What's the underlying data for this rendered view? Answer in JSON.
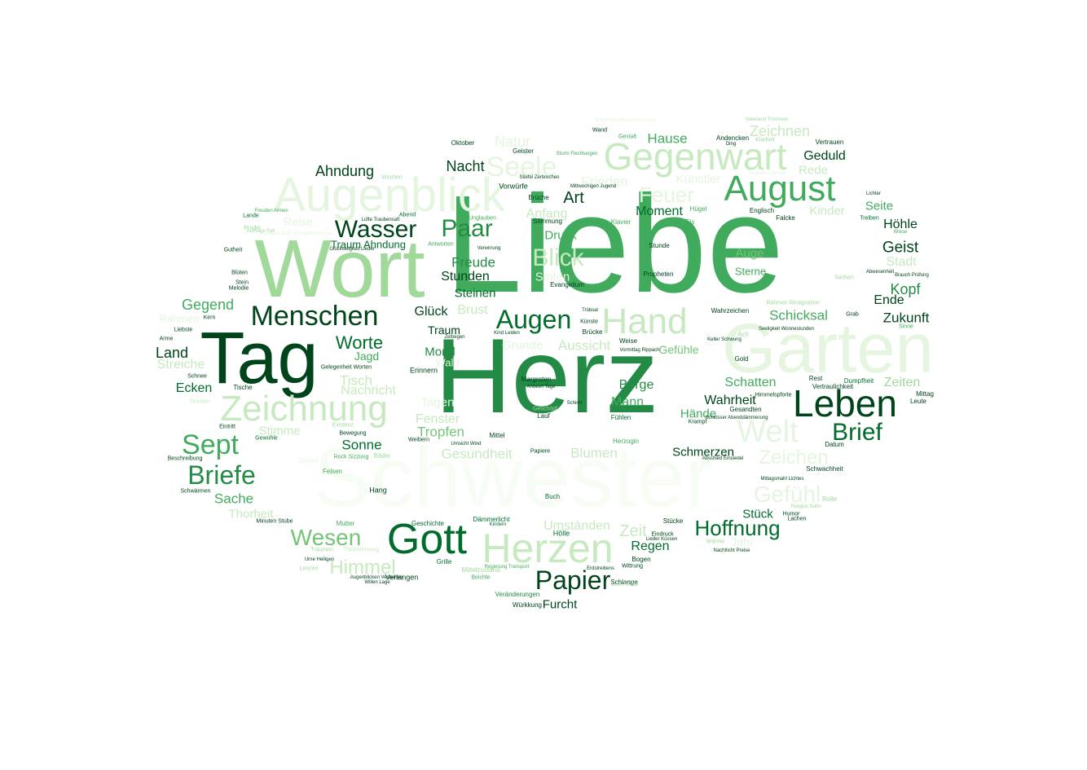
{
  "word_cloud": {
    "palette": {
      "darkest": "#00441b",
      "dark": "#006d2c",
      "medium_dark": "#238b45",
      "medium": "#41ab5d",
      "light": "#74c476",
      "lighter": "#a1d99b",
      "pale": "#c7e9c0",
      "palest": "#e5f5e0",
      "faint": "#f7fcf5"
    },
    "words": [
      {
        "text": "Liebe"
      },
      {
        "text": "Herz"
      },
      {
        "text": "Schwester"
      },
      {
        "text": "Wort"
      },
      {
        "text": "Tag"
      },
      {
        "text": "Garten"
      },
      {
        "text": "Augenblick"
      },
      {
        "text": "Gegenwart"
      },
      {
        "text": "Leben"
      },
      {
        "text": "Zeichnung"
      },
      {
        "text": "Hand"
      },
      {
        "text": "August"
      },
      {
        "text": "Herzen"
      },
      {
        "text": "Gott"
      },
      {
        "text": "Menschen"
      },
      {
        "text": "Welt"
      },
      {
        "text": "Wasser"
      },
      {
        "text": "Augen"
      },
      {
        "text": "Seele"
      },
      {
        "text": "Paar"
      },
      {
        "text": "Briefe"
      },
      {
        "text": "Sept"
      },
      {
        "text": "Papier"
      },
      {
        "text": "Brief"
      },
      {
        "text": "Blick"
      },
      {
        "text": "Wesen"
      },
      {
        "text": "Gefühl"
      },
      {
        "text": "Hoffnung"
      },
      {
        "text": "Feuer"
      },
      {
        "text": "Zeichen"
      },
      {
        "text": "Himmel"
      },
      {
        "text": "Worte"
      },
      {
        "text": "Ahndung"
      },
      {
        "text": "Nacht"
      },
      {
        "text": "Natur"
      },
      {
        "text": "Zeichnen"
      },
      {
        "text": "Hause"
      },
      {
        "text": "Geduld"
      },
      {
        "text": "Rede"
      },
      {
        "text": "Künstler"
      },
      {
        "text": "Frieden"
      },
      {
        "text": "Art"
      },
      {
        "text": "Anfang"
      },
      {
        "text": "Moment"
      },
      {
        "text": "Kinder"
      },
      {
        "text": "Seite"
      },
      {
        "text": "Höhle"
      },
      {
        "text": "Geist"
      },
      {
        "text": "Stadt"
      },
      {
        "text": "Kopf"
      },
      {
        "text": "Ende"
      },
      {
        "text": "Zukunft"
      },
      {
        "text": "Auge"
      },
      {
        "text": "Sterne"
      },
      {
        "text": "Schicksal"
      },
      {
        "text": "Druck"
      },
      {
        "text": "Freude"
      },
      {
        "text": "Seiten"
      },
      {
        "text": "Stunden"
      },
      {
        "text": "Steinen"
      },
      {
        "text": "Glück"
      },
      {
        "text": "Brust"
      },
      {
        "text": "Traum"
      },
      {
        "text": "Mond"
      },
      {
        "text": "Jagd"
      },
      {
        "text": "Land"
      },
      {
        "text": "Streiche"
      },
      {
        "text": "Gegend"
      },
      {
        "text": "Tisch"
      },
      {
        "text": "Nachricht"
      },
      {
        "text": "Ecken"
      },
      {
        "text": "Tagen"
      },
      {
        "text": "Fenster"
      },
      {
        "text": "Tropfen"
      },
      {
        "text": "Sonne"
      },
      {
        "text": "Stimme"
      },
      {
        "text": "Sache"
      },
      {
        "text": "Thorheit"
      },
      {
        "text": "Gesundheit"
      },
      {
        "text": "Blumen"
      },
      {
        "text": "Umständen"
      },
      {
        "text": "Zeit"
      },
      {
        "text": "Regen"
      },
      {
        "text": "Aussicht"
      },
      {
        "text": "Grunde"
      },
      {
        "text": "Gefühle"
      },
      {
        "text": "Berge"
      },
      {
        "text": "Mann"
      },
      {
        "text": "Wahrheit"
      },
      {
        "text": "Hände"
      },
      {
        "text": "Schatten"
      },
      {
        "text": "Zeiten"
      },
      {
        "text": "Schmerzen"
      },
      {
        "text": "Stück"
      },
      {
        "text": "Furcht"
      },
      {
        "text": "Jahr"
      },
      {
        "text": "Reise"
      },
      {
        "text": "Traum Ahndung"
      },
      {
        "text": "Rahmen"
      },
      {
        "text": "Wald"
      },
      {
        "text": "Erinnern"
      },
      {
        "text": "Oktober"
      },
      {
        "text": "Geister"
      },
      {
        "text": "Wand"
      },
      {
        "text": "Vorwürfe"
      },
      {
        "text": "Brüche"
      },
      {
        "text": "Stimmung"
      },
      {
        "text": "Klavier"
      },
      {
        "text": "Eis"
      },
      {
        "text": "Hügel"
      },
      {
        "text": "Englisch"
      },
      {
        "text": "Falcke"
      },
      {
        "text": "Andencken"
      },
      {
        "text": "Vertrauen"
      },
      {
        "text": "Stunde"
      },
      {
        "text": "Propheten"
      },
      {
        "text": "Evangelium"
      },
      {
        "text": "Wahrzeichen"
      },
      {
        "text": "Ach"
      },
      {
        "text": "Gold"
      },
      {
        "text": "Weise"
      },
      {
        "text": "Brücke"
      },
      {
        "text": "Künste"
      },
      {
        "text": "Wärme"
      },
      {
        "text": "Lachen"
      },
      {
        "text": "Humor"
      },
      {
        "text": "Stücke"
      },
      {
        "text": "Eindruck"
      },
      {
        "text": "Bogen"
      },
      {
        "text": "Wittrung"
      },
      {
        "text": "Schlange"
      },
      {
        "text": "Hölle"
      },
      {
        "text": "Dämmerlicht"
      },
      {
        "text": "Geschichte"
      },
      {
        "text": "Grille"
      },
      {
        "text": "Verlangen"
      },
      {
        "text": "Veränderungen"
      },
      {
        "text": "Würkkung"
      },
      {
        "text": "Buch"
      },
      {
        "text": "Hang"
      },
      {
        "text": "Felsen"
      },
      {
        "text": "Sinnen"
      },
      {
        "text": "Bilder"
      },
      {
        "text": "Papiere"
      },
      {
        "text": "Weibern"
      },
      {
        "text": "Mittel"
      },
      {
        "text": "Lauf"
      },
      {
        "text": "Geschöpf"
      },
      {
        "text": "Margreten"
      },
      {
        "text": "Fühlen"
      },
      {
        "text": "Herzogin"
      },
      {
        "text": "Krampf"
      },
      {
        "text": "Gesandten"
      },
      {
        "text": "Himmelspforte"
      },
      {
        "text": "Rest"
      },
      {
        "text": "Vertraulichkeit"
      },
      {
        "text": "Dumpfheit"
      },
      {
        "text": "Mittag"
      },
      {
        "text": "Leute"
      },
      {
        "text": "Datum"
      },
      {
        "text": "Schwachheit"
      },
      {
        "text": "Rolle"
      },
      {
        "text": "Eintritt"
      },
      {
        "text": "Gewühle"
      },
      {
        "text": "Existenz"
      },
      {
        "text": "Bewegung"
      },
      {
        "text": "Beschreibung"
      },
      {
        "text": "Schwärmen"
      },
      {
        "text": "Tische"
      },
      {
        "text": "Schnee"
      },
      {
        "text": "Stücken"
      },
      {
        "text": "Arme"
      },
      {
        "text": "Liebste"
      },
      {
        "text": "Kern"
      },
      {
        "text": "Blüten"
      },
      {
        "text": "Stein"
      },
      {
        "text": "Melodie"
      },
      {
        "text": "Gutheit"
      },
      {
        "text": "Lande"
      },
      {
        "text": "Bruder"
      },
      {
        "text": "Abend"
      },
      {
        "text": "Unglauben"
      },
      {
        "text": "Antworten"
      },
      {
        "text": "Verwirrung"
      },
      {
        "text": "Wochen"
      },
      {
        "text": "Treiben"
      },
      {
        "text": "Lichter"
      },
      {
        "text": "Wiese"
      },
      {
        "text": "Abwesenheit"
      },
      {
        "text": "Brauch Prüfung"
      },
      {
        "text": "Grab"
      },
      {
        "text": "Sinne"
      },
      {
        "text": "Rahmen Resignation"
      },
      {
        "text": "Sachen"
      },
      {
        "text": "Gestalt"
      },
      {
        "text": "Klarheit"
      },
      {
        "text": "Ding"
      },
      {
        "text": "Minuten Stube"
      },
      {
        "text": "Mutter"
      },
      {
        "text": "Theilnehmung"
      },
      {
        "text": "Lenzen"
      },
      {
        "text": "Träumen"
      },
      {
        "text": "Mittelzustand"
      },
      {
        "text": "Beichte"
      },
      {
        "text": "Kindern"
      },
      {
        "text": "Gelegenheit Worten"
      },
      {
        "text": "Rock Sizzung"
      },
      {
        "text": "Schirm"
      },
      {
        "text": "Kind Leiden"
      },
      {
        "text": "Zetteigen"
      },
      {
        "text": "Trübsal"
      },
      {
        "text": "Vormittag Rippach"
      },
      {
        "text": "Antwort Tage"
      },
      {
        "text": "Umsicht Wind"
      },
      {
        "text": "Religion Sohn"
      },
      {
        "text": "Keller Schwung"
      },
      {
        "text": "Erdstreibens"
      },
      {
        "text": "Regierung Transport"
      },
      {
        "text": "Lust Freude"
      },
      {
        "text": "Willen Lage"
      },
      {
        "text": "Augenblicken Verzeihen"
      },
      {
        "text": "Urne Heiligen"
      },
      {
        "text": "Lieder Küssen"
      },
      {
        "text": "Nachtlicht Preise"
      },
      {
        "text": "Mittagsmahl Lichtes"
      },
      {
        "text": "Abschied Einsiedel"
      },
      {
        "text": "Schlösser Abenddämmerung"
      },
      {
        "text": "Seeligkeit Wonnestunden"
      },
      {
        "text": "Vaterland Trümmen"
      },
      {
        "text": "Mittwochigen Jugend"
      },
      {
        "text": "Sturm Flechtungen"
      },
      {
        "text": "Lüfte Traubensaft"
      },
      {
        "text": "Freuden Armen"
      },
      {
        "text": "Aufträge Fall"
      },
      {
        "text": "Mitternacht Bewunderungen"
      },
      {
        "text": "Stiefel Zerbrechen"
      },
      {
        "text": "Gegenstand Übungsergebnisse"
      },
      {
        "text": "Glückseligkeit Lieder"
      },
      {
        "text": "Begleiter Liebling"
      },
      {
        "text": "Erkaltung Vielseitigkeit"
      }
    ]
  }
}
